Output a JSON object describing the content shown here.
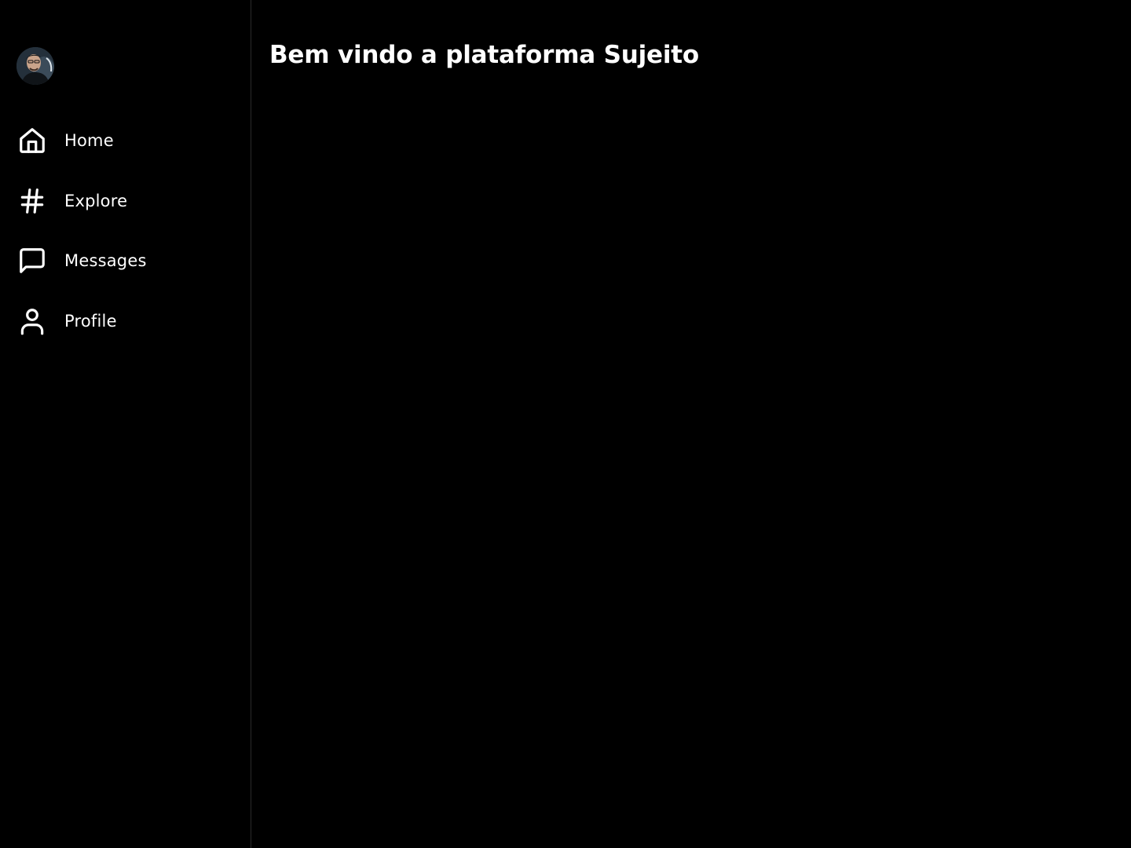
{
  "sidebar": {
    "avatar_icon": "user-photo",
    "items": [
      {
        "label": "Home",
        "icon": "home-icon"
      },
      {
        "label": "Explore",
        "icon": "hashtag-icon"
      },
      {
        "label": "Messages",
        "icon": "message-icon"
      },
      {
        "label": "Profile",
        "icon": "user-icon"
      }
    ]
  },
  "main": {
    "title": "Bem vindo a plataforma Sujeito"
  },
  "colors": {
    "background": "#000000",
    "text": "#ffffff",
    "divider": "#2a2a2a"
  }
}
